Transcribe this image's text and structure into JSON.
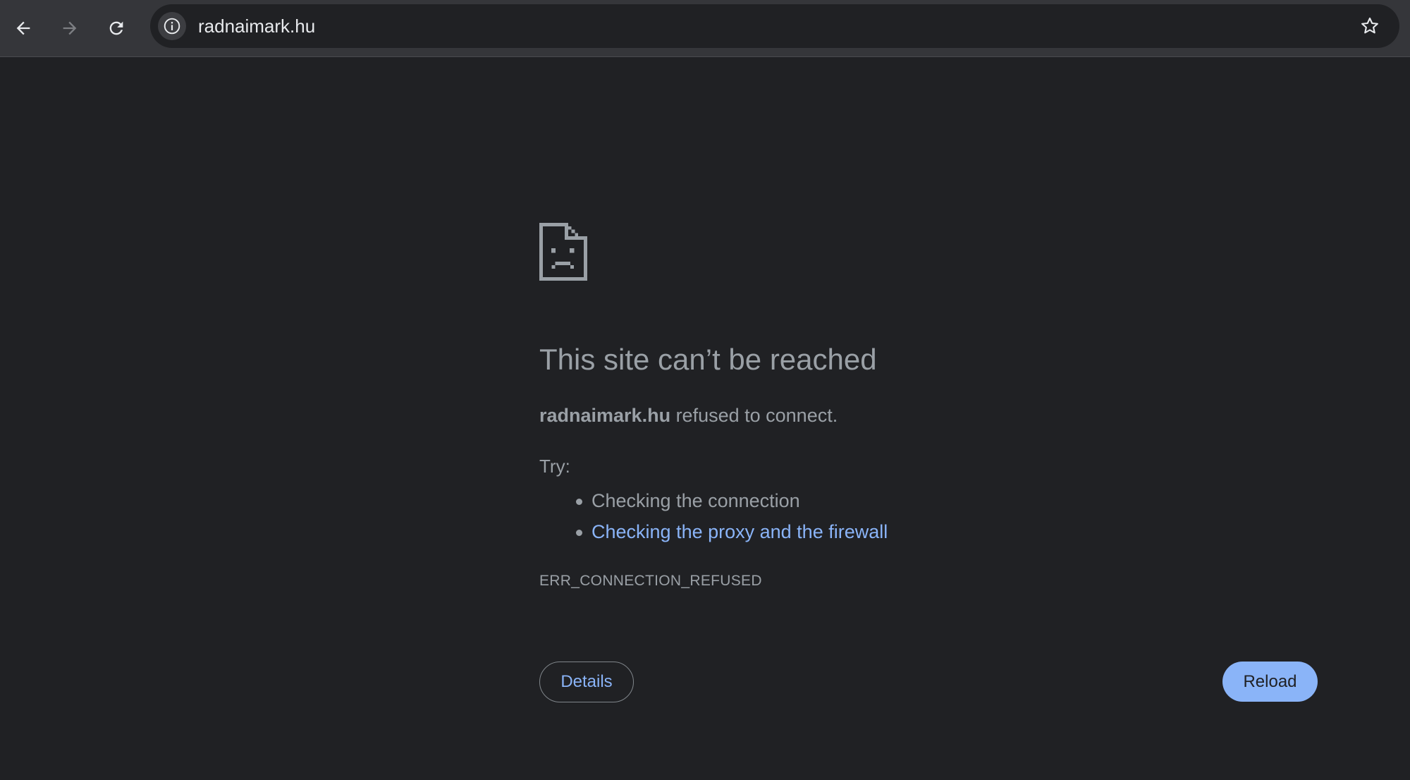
{
  "browser": {
    "url": "radnaimark.hu",
    "icons": {
      "back": "back-arrow-icon",
      "forward": "forward-arrow-icon",
      "reload": "reload-icon",
      "site_info": "info-icon",
      "bookmark": "star-icon"
    }
  },
  "error_page": {
    "icon": "sad-document-icon",
    "title": "This site can’t be reached",
    "host": "radnaimark.hu",
    "summary_suffix": " refused to connect.",
    "try_label": "Try:",
    "suggestions": [
      {
        "text": "Checking the connection",
        "is_link": false
      },
      {
        "text": "Checking the proxy and the firewall",
        "is_link": true
      }
    ],
    "error_code": "ERR_CONNECTION_REFUSED",
    "details_label": "Details",
    "reload_label": "Reload"
  },
  "colors": {
    "background": "#202124",
    "toolbar": "#35363a",
    "text": "#9aa0a6",
    "link": "#8ab4f8",
    "primary_button": "#8ab4f8"
  }
}
